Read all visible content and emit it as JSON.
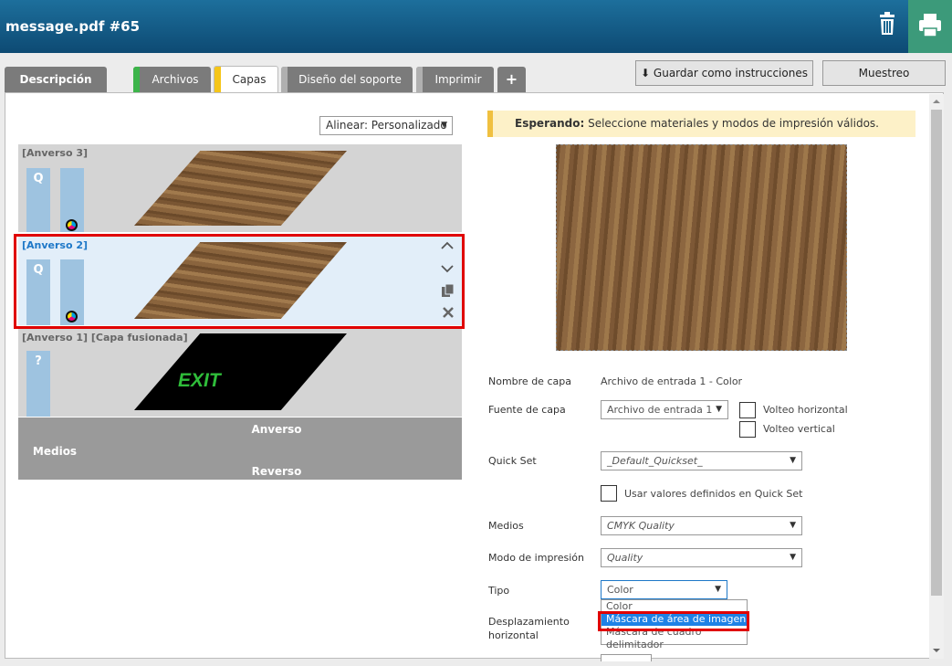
{
  "header": {
    "title": "message.pdf #65"
  },
  "tabs": [
    {
      "label": "Descripción",
      "color": ""
    },
    {
      "label": "Archivos",
      "color": "#3cb44a"
    },
    {
      "label": "Capas",
      "color": "#f5c518"
    },
    {
      "label": "Diseño del soporte",
      "color": "#b0b0b0"
    },
    {
      "label": "Imprimir",
      "color": "#b0b0b0"
    },
    {
      "label": "+",
      "color": ""
    }
  ],
  "toolbar": {
    "save_label": "Guardar como instrucciones",
    "sample_label": "Muestreo"
  },
  "layers_panel": {
    "align_value": "Alinear: Personalizado",
    "layers": [
      {
        "name": "[Anverso 3]",
        "bar1": "Q"
      },
      {
        "name": "[Anverso 2]",
        "bar1": "Q"
      },
      {
        "name": "[Anverso 1] [Capa fusionada]",
        "bar1": "?",
        "content": "EXIT"
      }
    ],
    "media": {
      "label": "Medios",
      "front": "Anverso",
      "back": "Reverso"
    }
  },
  "status": {
    "prefix": "Esperando:",
    "message": "Seleccione materiales y modos de impresión válidos."
  },
  "form": {
    "layer_name_label": "Nombre de capa",
    "layer_name_value": "Archivo de entrada 1 - Color",
    "layer_source_label": "Fuente de capa",
    "layer_source_value": "Archivo de entrada 1",
    "flip_h_label": "Volteo horizontal",
    "flip_v_label": "Volteo vertical",
    "quickset_label": "Quick Set",
    "quickset_value": "_Default_Quickset_",
    "use_quickset_label": "Usar valores definidos en Quick Set",
    "media_label": "Medios",
    "media_value": "CMYK Quality",
    "print_mode_label": "Modo de impresión",
    "print_mode_value": "Quality",
    "type_label": "Tipo",
    "type_value": "Color",
    "type_options": [
      "Color",
      "Máscara de área de imagen",
      "Máscara de cuadro delimitador"
    ],
    "offset_label_1": "Desplazamiento",
    "offset_label_2": "horizontal"
  }
}
